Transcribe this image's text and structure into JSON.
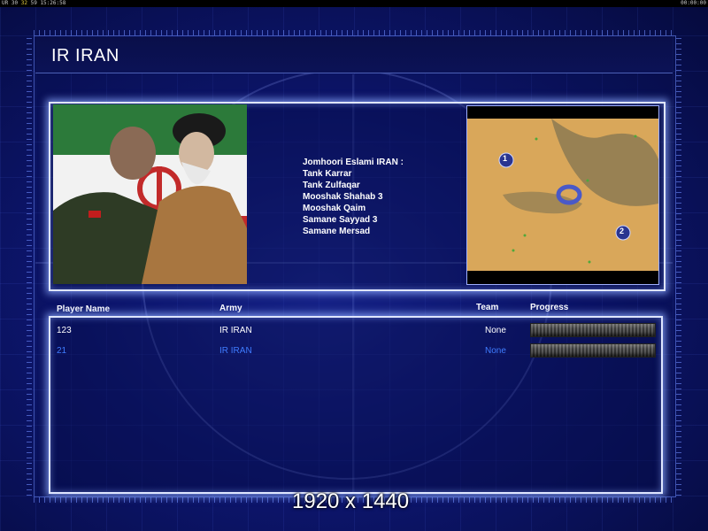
{
  "hud": {
    "left_prefix": "UR",
    "left_fps": "30",
    "left_value": "32",
    "left_extra": "59",
    "left_clock": "15:26:58",
    "right_clock": "00:00:00"
  },
  "title": "IR IRAN",
  "units": {
    "heading": "Jomhoori Eslami IRAN :",
    "items": [
      "Tank Karrar",
      "Tank Zulfaqar",
      "Mooshak Shahab 3",
      "Mooshak Qaim",
      "Samane Sayyad 3",
      "Samane Mersad"
    ]
  },
  "minimap": {
    "start_positions": [
      "1",
      "2"
    ]
  },
  "players": {
    "headers": {
      "name": "Player Name",
      "army": "Army",
      "team": "Team",
      "progress": "Progress"
    },
    "rows": [
      {
        "name": "123",
        "army": "IR IRAN",
        "team": "None",
        "progress": 1.0
      },
      {
        "name": "21",
        "army": "IR IRAN",
        "team": "None",
        "progress": 1.0
      }
    ]
  },
  "resolution_label": "1920 x 1440",
  "colors": {
    "local_player": "#ffffff",
    "other_player": "#3f7cff",
    "panel_border": "#dfe6ff"
  }
}
